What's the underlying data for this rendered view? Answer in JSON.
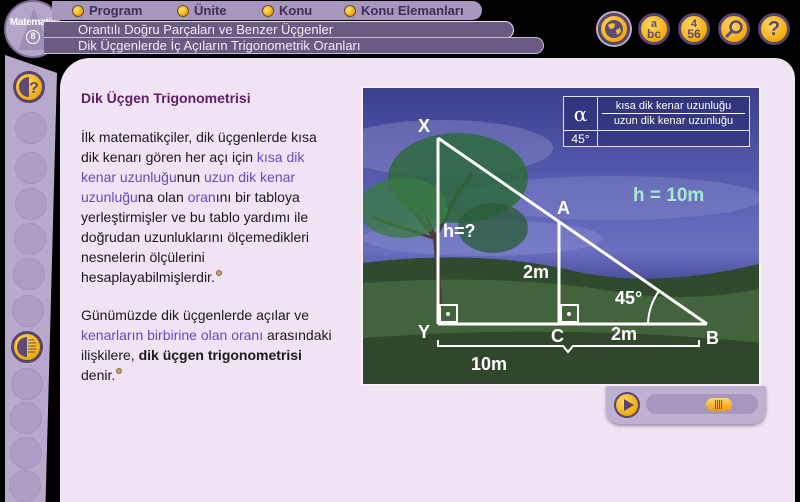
{
  "logo": {
    "title": "Matematik",
    "grade": "8"
  },
  "topnav": {
    "items": [
      {
        "label": "Program"
      },
      {
        "label": "Ünite"
      },
      {
        "label": "Konu"
      },
      {
        "label": "Konu Elemanları"
      }
    ]
  },
  "breadcrumb": {
    "unit": "Orantılı Doğru Parçaları ve Benzer Üçgenler",
    "topic": "Dik Üçgenlerde İç Açıların Trigonometrik Oranları"
  },
  "toolbar": {
    "buttons": [
      {
        "name": "globe-icon",
        "label": ""
      },
      {
        "name": "glossary-abc-icon",
        "label_top": "a",
        "label_bottom": "bc"
      },
      {
        "name": "numbers-icon",
        "label_top": "4",
        "label_bottom": "56"
      },
      {
        "name": "search-icon",
        "label": ""
      },
      {
        "name": "help-icon",
        "label": "?"
      }
    ]
  },
  "sidebar": {
    "active_top": "info-question",
    "active_bottom": "contrast"
  },
  "content": {
    "heading": "Dik Üçgen Trigonometrisi",
    "p1": {
      "t1": "İlk matematikçiler, dik üçgenlerde kısa dik kenarı gören her açı için ",
      "h1": "kısa dik kenar uzunluğu",
      "t2": "nun ",
      "h2": "uzun dik kenar uzunluğu",
      "t3": "na olan ",
      "h3": "oran",
      "t4": "ını bir tabloya yerleştirmişler ve bu tablo yardımı ile doğrudan uzunluklarını ölçemedikleri nesnelerin ölçülerini hesaplayabilmişlerdir."
    },
    "p2": {
      "t1": "Günümüzde dik üçgenlerde açılar ve ",
      "h1": "kenarların birbirine olan oranı",
      "t2": " arasındaki ilişkilere, ",
      "b1": "dik üçgen trigonometrisi",
      "t3": " denir."
    }
  },
  "figure": {
    "table": {
      "alpha": "α",
      "numerator": "kısa dik kenar uzunluğu",
      "denominator": "uzun dik kenar uzunluğu",
      "angle": "45°",
      "value": ""
    },
    "labels": {
      "X": "X",
      "Y": "Y",
      "A": "A",
      "B": "B",
      "C": "C",
      "h_unknown": "h=?",
      "h_result": "h = 10m",
      "AC": "2m",
      "CB": "2m",
      "YB": "10m",
      "angle_B": "45°"
    }
  },
  "player": {
    "progress": 0.72
  }
}
